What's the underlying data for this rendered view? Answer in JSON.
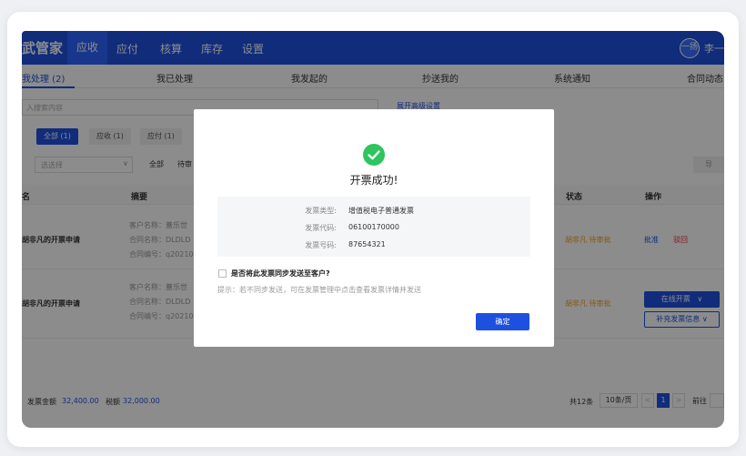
{
  "app": {
    "logo": "武管家",
    "nav": [
      "应收",
      "应付",
      "核算",
      "库存",
      "设置"
    ],
    "avatar": "一扬",
    "username": "李一"
  },
  "tabs": [
    "我处理 (2)",
    "我已处理",
    "我发起的",
    "抄送我的",
    "系统通知",
    "合同动态"
  ],
  "search": {
    "placeholder": "入搜索内容",
    "advanced": "展开高级设置"
  },
  "filters": [
    "全部 (1)",
    "应收 (1)",
    "应付 (1)"
  ],
  "select": {
    "placeholder": "选选择",
    "quick_all": "全部",
    "quick_pending": "待审",
    "right_button": "导"
  },
  "table": {
    "headers": {
      "name": "名",
      "summary": "摘要",
      "status": "状态",
      "ops": "操作"
    },
    "rows": [
      {
        "title": "胡非凡的开票申请",
        "summary": [
          "客户名称：蓋乐世",
          "合同名称：DLDLD",
          "合同编号：q20210"
        ],
        "status": "胡非凡 待审批",
        "op_approve": "批准",
        "op_reject": "驳回"
      },
      {
        "title": "胡非凡的开票申请",
        "summary": [
          "客户名称：蓋乐世",
          "合同名称：DLDLD",
          "合同编号：q20210"
        ],
        "status": "胡非凡 待审批",
        "op_invoice": "在线开票",
        "op_supplement": "补充发票信息"
      }
    ]
  },
  "footer": {
    "invoice_label": "发票金额",
    "invoice_amount": "32,400.00",
    "tax_label": "税额",
    "tax_amount": "32,000.00",
    "total": "共12条",
    "page_size": "10条/页",
    "prev": "<",
    "page": "1",
    "next": ">",
    "goto": "前往"
  },
  "modal": {
    "title": "开票成功!",
    "info": [
      {
        "label": "发票类型:",
        "value": "增值税电子普通发票"
      },
      {
        "label": "发票代码:",
        "value": "06100170000"
      },
      {
        "label": "发票号码:",
        "value": "87654321"
      }
    ],
    "sync_label": "是否将此发票同步发送至客户?",
    "hint": "提示：若不同步发送，可在发票管理中点击查看发票详情并发送",
    "confirm": "确定"
  },
  "colors": {
    "primary": "#1e50e0",
    "success": "#2ec45e",
    "warning": "#f0a020",
    "danger": "#e33333"
  }
}
